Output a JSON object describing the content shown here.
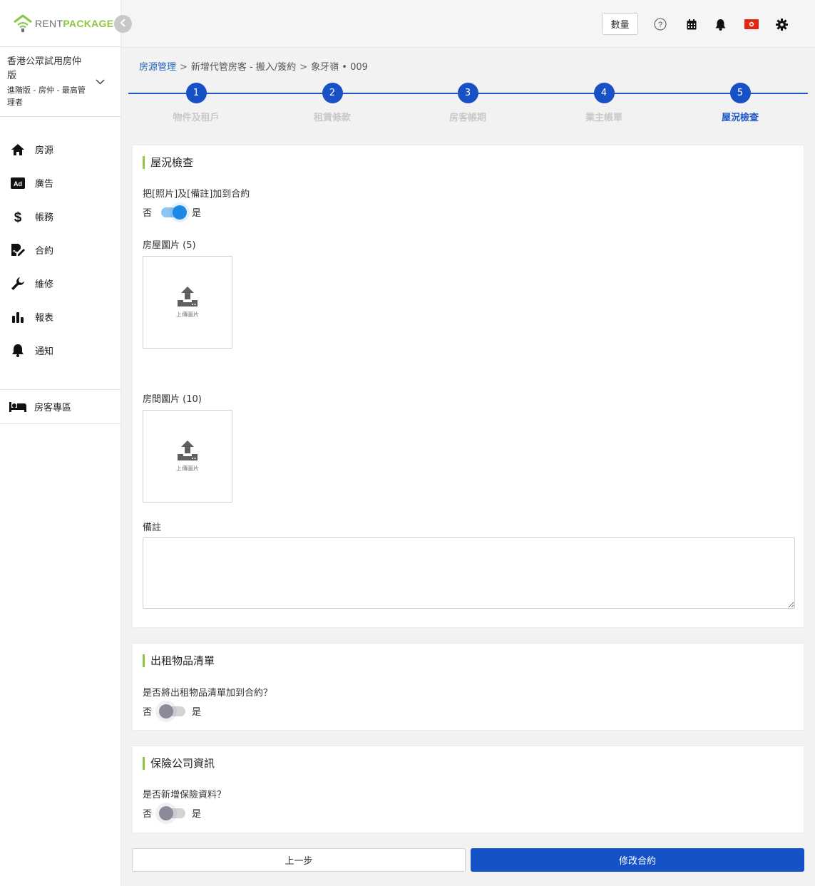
{
  "brand": {
    "rent": "RENT",
    "package": "PACKAGE"
  },
  "org": {
    "name": "香港公眾試用房仲版",
    "role": "進階版 - 房仲 - 最高管理者"
  },
  "sidebar": {
    "items": [
      {
        "label": "房源",
        "icon": "home-icon"
      },
      {
        "label": "廣告",
        "icon": "ad-icon"
      },
      {
        "label": "帳務",
        "icon": "dollar-icon"
      },
      {
        "label": "合約",
        "icon": "contract-icon"
      },
      {
        "label": "維修",
        "icon": "wrench-icon"
      },
      {
        "label": "報表",
        "icon": "bar-chart-icon"
      },
      {
        "label": "通知",
        "icon": "bell-icon"
      }
    ],
    "tenant_zone": {
      "label": "房客專區",
      "icon": "bed-icon"
    }
  },
  "topbar": {
    "qty_label": "數量",
    "icons": [
      "help-icon",
      "calendar-icon",
      "bell-icon",
      "flag-icon",
      "gear-icon"
    ]
  },
  "breadcrumb": {
    "root": "房源管理",
    "sep": ">",
    "middle": "新增代管房客 - 搬入/簽約",
    "current": "象牙嶺 • 009"
  },
  "stepper": {
    "steps": [
      {
        "num": "1",
        "label": "物件及租戶"
      },
      {
        "num": "2",
        "label": "租賃條款"
      },
      {
        "num": "3",
        "label": "房客帳期"
      },
      {
        "num": "4",
        "label": "業主帳單"
      },
      {
        "num": "5",
        "label": "屋況檢查"
      }
    ],
    "active_index": 4
  },
  "inspection": {
    "title": "屋況檢查",
    "add_to_contract_label": "把[照片]及[備註]加到合約",
    "no_label": "否",
    "yes_label": "是",
    "add_to_contract_on": true,
    "house_photos_label": "房屋圖片 (5)",
    "room_photos_label": "房間圖片 (10)",
    "upload_label": "上傳圖片",
    "remarks_label": "備註",
    "remarks_value": ""
  },
  "rental_items": {
    "title": "出租物品清單",
    "question": "是否將出租物品清單加到合約？",
    "no_label": "否",
    "yes_label": "是",
    "on": false
  },
  "insurance": {
    "title": "保險公司資訊",
    "question": "是否新增保險資料？",
    "no_label": "否",
    "yes_label": "是",
    "on": false
  },
  "actions": {
    "prev_label": "上一步",
    "submit_label": "修改合約"
  },
  "colors": {
    "primary": "#1552c7",
    "accent_green": "#8dc63f",
    "toggle_on": "#1e88e5"
  }
}
